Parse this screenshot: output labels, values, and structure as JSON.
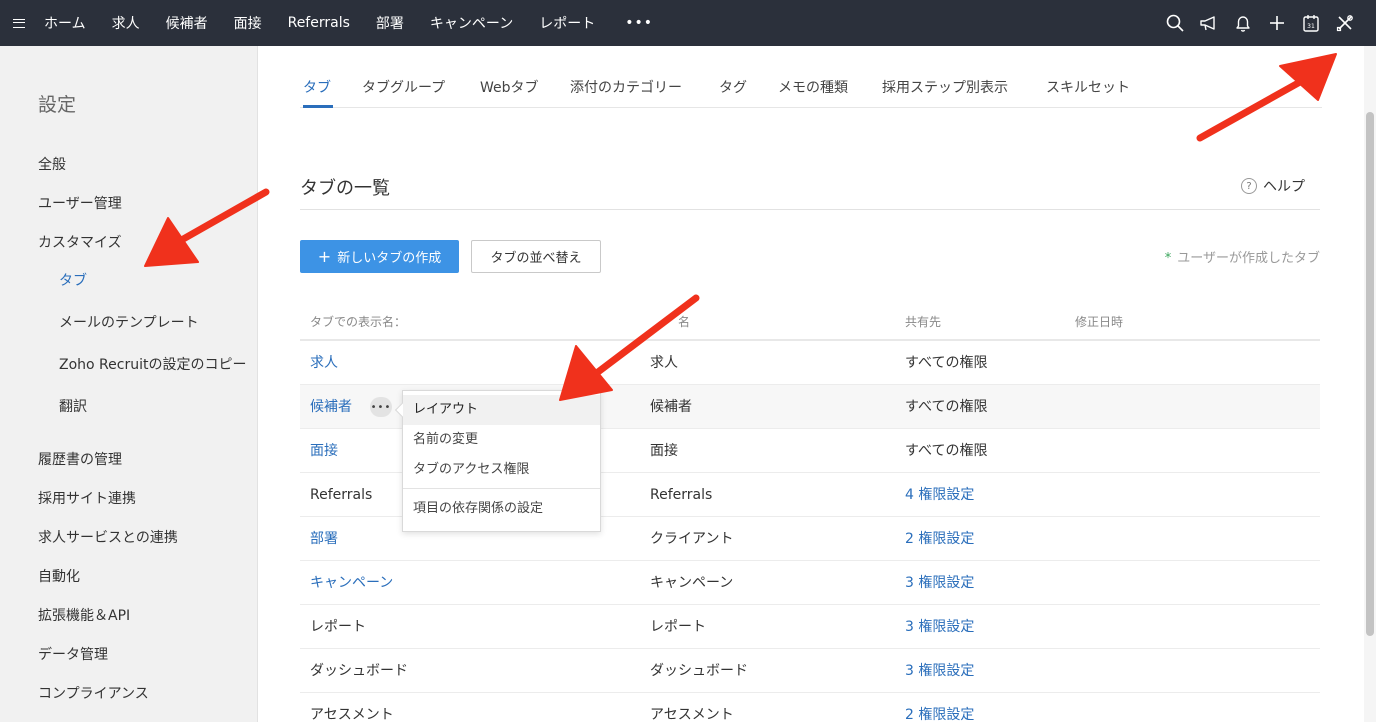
{
  "topnav": {
    "items": [
      "ホーム",
      "求人",
      "候補者",
      "面接",
      "Referrals",
      "部署",
      "キャンペーン",
      "レポート"
    ],
    "more": "•••",
    "icons": [
      "search-icon",
      "megaphone-icon",
      "bell-icon",
      "plus-icon",
      "calendar-icon",
      "tools-icon"
    ],
    "calendar_day": "31"
  },
  "sidebar": {
    "title": "設定",
    "items": [
      {
        "label": "全般"
      },
      {
        "label": "ユーザー管理"
      },
      {
        "label": "カスタマイズ"
      },
      {
        "label": "タブ"
      },
      {
        "label": "メールのテンプレート"
      },
      {
        "label": "Zoho Recruitの設定のコピー"
      },
      {
        "label": "翻訳"
      },
      {
        "label": "履歴書の管理"
      },
      {
        "label": "採用サイト連携"
      },
      {
        "label": "求人サービスとの連携"
      },
      {
        "label": "自動化"
      },
      {
        "label": "拡張機能＆API"
      },
      {
        "label": "データ管理"
      },
      {
        "label": "コンプライアンス"
      }
    ]
  },
  "tabs": [
    "タブ",
    "タブグループ",
    "Webタブ",
    "添付のカテゴリー",
    "タグ",
    "メモの種類",
    "採用ステップ別表示",
    "スキルセット"
  ],
  "page": {
    "title": "タブの一覧",
    "help": "ヘルプ",
    "help_glyph": "?",
    "new_tab_button": "新しいタブの作成",
    "new_tab_plus": "+",
    "reorder_button": "タブの並べ替え",
    "legend": "ユーザーが作成したタブ",
    "legend_star": "*"
  },
  "table": {
    "headers": [
      "タブでの表示名：",
      "名",
      "共有先",
      "修正日時"
    ],
    "rows": [
      {
        "display": "求人",
        "name": "求人",
        "shared": "すべての権限"
      },
      {
        "display": "候補者",
        "name": "候補者",
        "shared": "すべての権限"
      },
      {
        "display": "面接",
        "name": "面接",
        "shared": "すべての権限"
      },
      {
        "display": "Referrals",
        "name": "Referrals",
        "shared": "4 権限設定"
      },
      {
        "display": "部署",
        "name": "クライアント",
        "shared": "2 権限設定"
      },
      {
        "display": "キャンペーン",
        "name": "キャンペーン",
        "shared": "3 権限設定"
      },
      {
        "display": "レポート",
        "name": "レポート",
        "shared": "3 権限設定"
      },
      {
        "display": "ダッシュボード",
        "name": "ダッシュボード",
        "shared": "3 権限設定"
      },
      {
        "display": "アセスメント",
        "name": "アセスメント",
        "shared": "2 権限設定"
      }
    ],
    "more_glyph": "•••"
  },
  "context_menu": {
    "items": [
      "レイアウト",
      "名前の変更",
      "タブのアクセス権限",
      "項目の依存関係の設定"
    ]
  },
  "colors": {
    "topbar": "#2b303b",
    "accent": "#2a6ebb",
    "primary_button": "#3d93e5",
    "annotation": "#f0311c"
  }
}
